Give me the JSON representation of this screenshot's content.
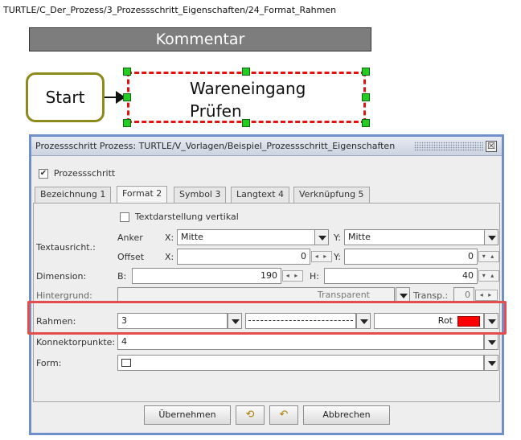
{
  "breadcrumb": "TURTLE/C_Der_Prozess/3_Prozessschritt_Eigenschaften/24_Format_Rahmen",
  "diagram": {
    "comment_label": "Kommentar",
    "start_label": "Start",
    "process_line1": "Wareneingang",
    "process_line2": "Prüfen"
  },
  "dialog": {
    "title": "Prozessschritt Prozess: TURTLE/V_Vorlagen/Beispiel_Prozessschritt_Eigenschaften",
    "close_symbol": "☒",
    "process_checkbox_label": "Prozessschritt",
    "process_checked": true,
    "tabs": [
      {
        "label": "Bezeichnung 1"
      },
      {
        "label": "Format 2"
      },
      {
        "label": "Symbol 3"
      },
      {
        "label": "Langtext 4"
      },
      {
        "label": "Verknüpfung 5"
      }
    ],
    "active_tab": "Format 2",
    "format": {
      "vertical_text_label": "Textdarstellung vertikal",
      "vertical_text_checked": false,
      "text_alignment_label": "Textausricht.:",
      "anchor_label": "Anker",
      "offset_label": "Offset",
      "x_label": "X:",
      "y_label": "Y:",
      "anchor_x": "Mitte",
      "anchor_y": "Mitte",
      "offset_x": "0",
      "offset_y": "0",
      "dimension_label": "Dimension:",
      "b_label": "B:",
      "h_label": "H:",
      "width": "190",
      "height": "40",
      "background_label": "Hintergrund:",
      "background_value": "Transparent",
      "transp_label": "Transp.:",
      "transp_value": "0",
      "frame_label": "Rahmen:",
      "frame_width": "3",
      "frame_color": "Rot",
      "frame_color_hex": "#ff0000",
      "connector_label": "Konnektorpunkte:",
      "connector_value": "4",
      "shape_label": "Form:"
    },
    "buttons": {
      "apply": "Übernehmen",
      "cancel": "Abbrechen"
    }
  },
  "colors": {
    "highlight": "#e44d4d",
    "dialog_border": "#6f8fc9",
    "handle": "#22cc22",
    "process_border": "#e41111",
    "start_border": "#8c8a1b"
  }
}
